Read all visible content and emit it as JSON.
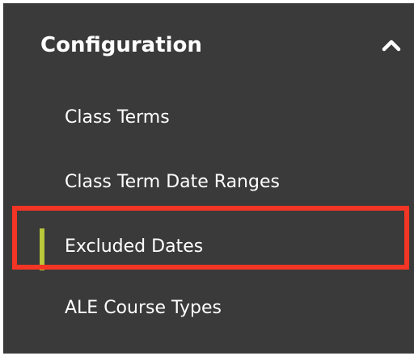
{
  "sidebar": {
    "section": {
      "title": "Configuration",
      "expanded": true,
      "toggle_icon": "chevron-up-icon"
    },
    "items": [
      {
        "label": "Class Terms",
        "active": false
      },
      {
        "label": "Class Term Date Ranges",
        "active": false
      },
      {
        "label": "Excluded Dates",
        "active": true
      },
      {
        "label": "ALE Course Types",
        "active": false
      }
    ]
  },
  "colors": {
    "panel_background": "#3a3a3a",
    "text": "#ffffff",
    "active_indicator": "#b9c73a",
    "highlight_outline": "#f23524"
  }
}
